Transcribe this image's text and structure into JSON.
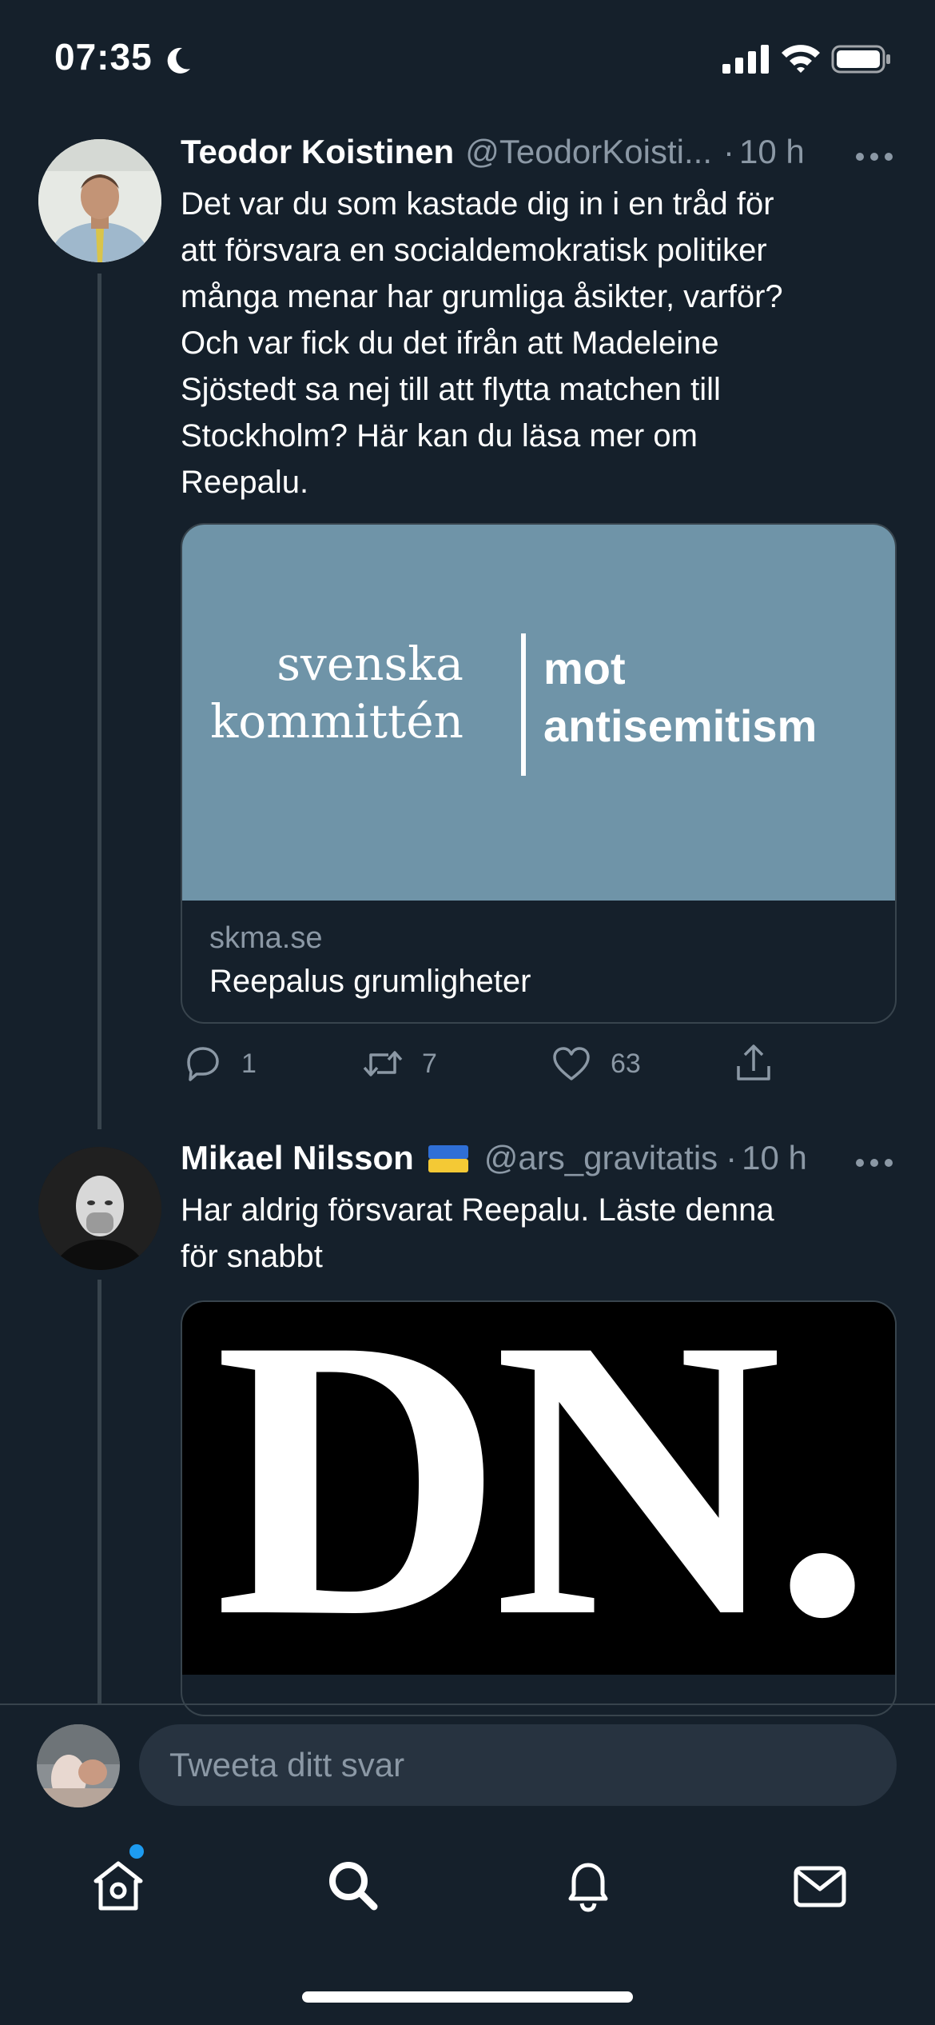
{
  "status_bar": {
    "time": "07:35",
    "icons": [
      "moon-icon",
      "signal-icon",
      "wifi-icon",
      "battery-icon"
    ]
  },
  "tweets": [
    {
      "name": "Teodor Koistinen",
      "handle": "@TeodorKoisti...",
      "separator": "·",
      "time": "10 h",
      "text_lines": [
        "Det var du som kastade dig in i en tråd för",
        "att försvara en socialdemokratisk politiker",
        "många menar har grumliga åsikter, varför?",
        "Och var fick du det ifrån att Madeleine",
        "Sjöstedt sa nej till att flytta matchen till",
        "Stockholm? Här kan du läsa mer om",
        "Reepalu."
      ],
      "card": {
        "logo_left_line1": "svenska",
        "logo_left_line2": "kommittén",
        "logo_right_line1": "mot",
        "logo_right_line2": "antisemitism",
        "domain": "skma.se",
        "title": "Reepalus grumligheter",
        "image_color": "#6f94a8"
      },
      "actions": {
        "replies": "1",
        "retweets": "7",
        "likes": "63"
      }
    },
    {
      "name": "Mikael Nilsson",
      "flag": "🇺🇦",
      "handle": "@ars_gravitatis",
      "separator": "·",
      "time": "10 h",
      "text_lines": [
        "Har aldrig försvarat Reepalu. Läste denna",
        "för snabbt"
      ],
      "card": {
        "logo": "DN."
      }
    }
  ],
  "compose": {
    "placeholder": "Tweeta ditt svar"
  },
  "tab_bar": {
    "tabs": [
      "home-icon",
      "search-icon",
      "bell-icon",
      "mail-icon"
    ],
    "accent_color": "#1d9bf0"
  },
  "colors": {
    "background": "#15202b",
    "secondary_text": "#8b98a5",
    "border": "#38444d"
  }
}
